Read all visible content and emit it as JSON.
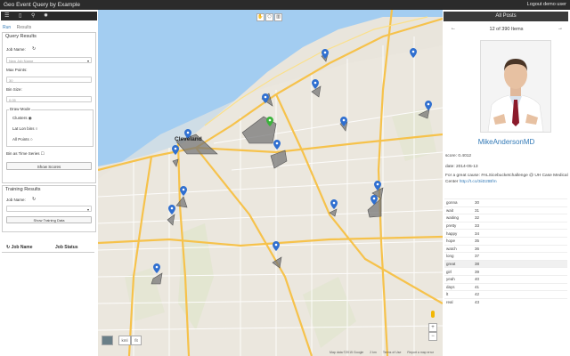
{
  "app": {
    "title": "Geo Event Query by Example",
    "logout": "Logout demo user"
  },
  "left_panel": {
    "icon_bar": [
      {
        "icon": "menu-icon",
        "glyph": "☰"
      },
      {
        "icon": "document-icon",
        "glyph": "▯"
      },
      {
        "icon": "map-marker-icon",
        "glyph": "⚲"
      },
      {
        "icon": "gear-icon",
        "glyph": "✹"
      }
    ],
    "tabs": [
      "Run",
      "Results"
    ],
    "query_results": {
      "title": "Query Results",
      "job_name_label": "Job Name:",
      "job_name_placeholder": "New Job Name",
      "max_points_label": "Max Points:",
      "max_points_value": "30",
      "bin_size_label": "Bin Size:",
      "bin_size_value": "0.05",
      "draw_mode_label": "Draw Mode",
      "draw_modes": [
        "Clusters",
        "Lat Lon bins",
        "All Points"
      ],
      "bin_time_series_label": "Bin as Time Series",
      "show_scores_button": "Show Scores"
    },
    "training_results": {
      "title": "Training Results",
      "job_name_label": "Job Name:",
      "show_training_button": "Show Training Data"
    },
    "columns": [
      "Job Name",
      "Job Status"
    ]
  },
  "map": {
    "tools": [
      "hand-icon",
      "polygon-icon",
      "delete-icon"
    ],
    "labels": {
      "cleveland": "Cleveland"
    },
    "kml_labels": [
      "kml",
      "fit"
    ],
    "footer": [
      "Map data ©2015 Google",
      "2 km",
      "Terms of Use",
      "Report a map error"
    ]
  },
  "right_panel": {
    "title": "All Posts",
    "counter": "12 of 390 Items",
    "prev_glyph": "←",
    "next_glyph": "→",
    "username": "MikeAndersonMD",
    "score": "score: 0.4012",
    "date": "date: 2014-05-13",
    "tweet_text": "For a great cause: #ALSicebucketchallenge @ UH Case Medical Center",
    "tweet_link": "http://t.co/3iiD2tBfm",
    "words": [
      {
        "word": "gonna",
        "count": "30"
      },
      {
        "word": "wait",
        "count": "31"
      },
      {
        "word": "waiting",
        "count": "32"
      },
      {
        "word": "pretty",
        "count": "33"
      },
      {
        "word": "happy",
        "count": "34"
      },
      {
        "word": "hope",
        "count": "35"
      },
      {
        "word": "watch",
        "count": "36"
      },
      {
        "word": "long",
        "count": "37"
      },
      {
        "word": "great",
        "count": "38"
      },
      {
        "word": "girl",
        "count": "39"
      },
      {
        "word": "yeah",
        "count": "40"
      },
      {
        "word": "days",
        "count": "41"
      },
      {
        "word": "lt",
        "count": "42"
      },
      {
        "word": "real",
        "count": "43"
      }
    ],
    "selected_word_index": 8
  },
  "colors": {
    "accent": "#337ab7",
    "marker_blue": "#2f6fd0",
    "marker_green": "#3bb33b",
    "lake": "#a3cdf1",
    "road_major": "#f6c24b"
  }
}
